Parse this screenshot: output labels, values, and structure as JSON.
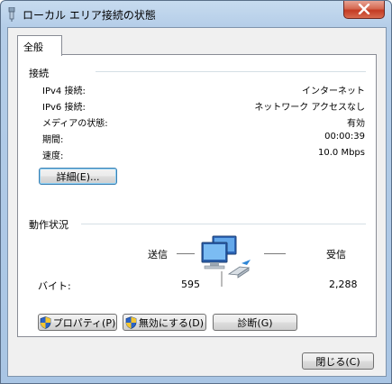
{
  "window": {
    "title": "ローカル エリア接続の状態"
  },
  "tabs": [
    {
      "label": "全般"
    }
  ],
  "connection": {
    "heading": "接続",
    "rows": [
      {
        "label": "IPv4 接続:",
        "value": "インターネット"
      },
      {
        "label": "IPv6 接続:",
        "value": "ネットワーク アクセスなし"
      },
      {
        "label": "メディアの状態:",
        "value": "有効"
      },
      {
        "label": "期間:",
        "value": "00:00:39"
      },
      {
        "label": "速度:",
        "value": "10.0 Mbps"
      }
    ],
    "details_button": "詳細(E)..."
  },
  "activity": {
    "heading": "動作状況",
    "sent_label": "送信",
    "received_label": "受信",
    "bytes_label": "バイト:",
    "sent_value": "595",
    "received_value": "2,288"
  },
  "buttons": {
    "properties": "プロパティ(P)",
    "disable": "無効にする(D)",
    "diagnose": "診断(G)",
    "close": "閉じる(C)"
  },
  "icons": [
    "connection-icon",
    "close-icon",
    "shield-icon",
    "network-computers-icon"
  ]
}
